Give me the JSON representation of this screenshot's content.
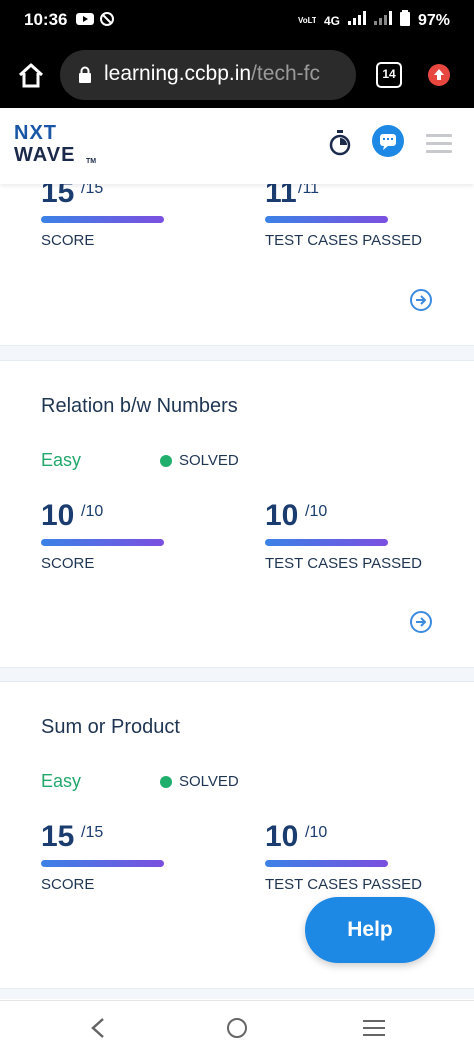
{
  "status_bar": {
    "time": "10:36",
    "network_small": "VoLTE1",
    "network_type": "4G",
    "battery": "97%"
  },
  "browser": {
    "url_main": "learning.ccbp.in",
    "url_rest": "/tech-fc",
    "tab_count": "14"
  },
  "app": {
    "logo_line1": "NXT",
    "logo_line2": "WAVE",
    "logo_tm": "TM"
  },
  "cards": [
    {
      "title": "",
      "difficulty": "",
      "status": "",
      "score": {
        "value": "15",
        "total": "/15",
        "label": "SCORE"
      },
      "tests": {
        "value": "11",
        "total": "/11",
        "label": "TEST CASES PASSED"
      }
    },
    {
      "title": "Relation b/w Numbers",
      "difficulty": "Easy",
      "status": "SOLVED",
      "score": {
        "value": "10",
        "total": "/10",
        "label": "SCORE"
      },
      "tests": {
        "value": "10",
        "total": "/10",
        "label": "TEST CASES PASSED"
      }
    },
    {
      "title": "Sum or Product",
      "difficulty": "Easy",
      "status": "SOLVED",
      "score": {
        "value": "15",
        "total": "/15",
        "label": "SCORE"
      },
      "tests": {
        "value": "10",
        "total": "/10",
        "label": "TEST CASES PASSED"
      }
    }
  ],
  "help_label": "Help",
  "colors": {
    "brand_blue": "#1e88e5",
    "easy_green": "#23a86b",
    "solved_dot": "#1fae6b",
    "heading": "#1f3552"
  }
}
